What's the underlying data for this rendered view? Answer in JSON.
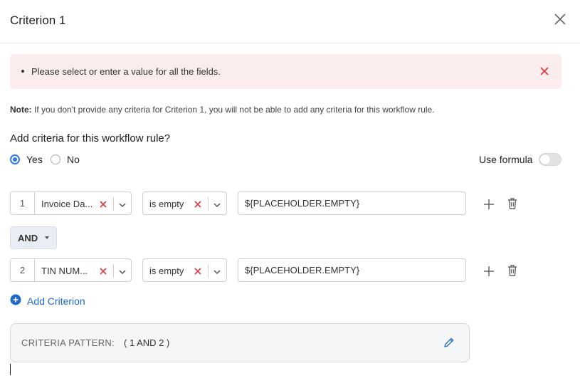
{
  "dialog": {
    "title": "Criterion 1"
  },
  "alert": {
    "message": "Please select or enter a value for all the fields."
  },
  "note": {
    "label": "Note:",
    "text": "If you don't provide any criteria for Criterion 1, you will not be able to add any criteria for this workflow rule."
  },
  "question": {
    "text": "Add criteria for this workflow rule?"
  },
  "options": {
    "yes": "Yes",
    "no": "No",
    "selected": "Yes"
  },
  "formula": {
    "label": "Use formula",
    "enabled": false
  },
  "criteria": [
    {
      "number": "1",
      "field": "Invoice Da...",
      "operator": "is empty",
      "value": "${PLACEHOLDER.EMPTY}"
    },
    {
      "number": "2",
      "field": "TIN NUM...",
      "operator": "is empty",
      "value": "${PLACEHOLDER.EMPTY}"
    }
  ],
  "connector": {
    "label": "AND"
  },
  "add_criterion": {
    "label": "Add Criterion"
  },
  "pattern": {
    "label": "CRITERIA PATTERN:",
    "value": "( 1 AND 2 )"
  },
  "colors": {
    "accent": "#2f7be6",
    "link": "#1f69c8",
    "error_x": "#e0383e",
    "alert_bg": "#fbeded"
  }
}
